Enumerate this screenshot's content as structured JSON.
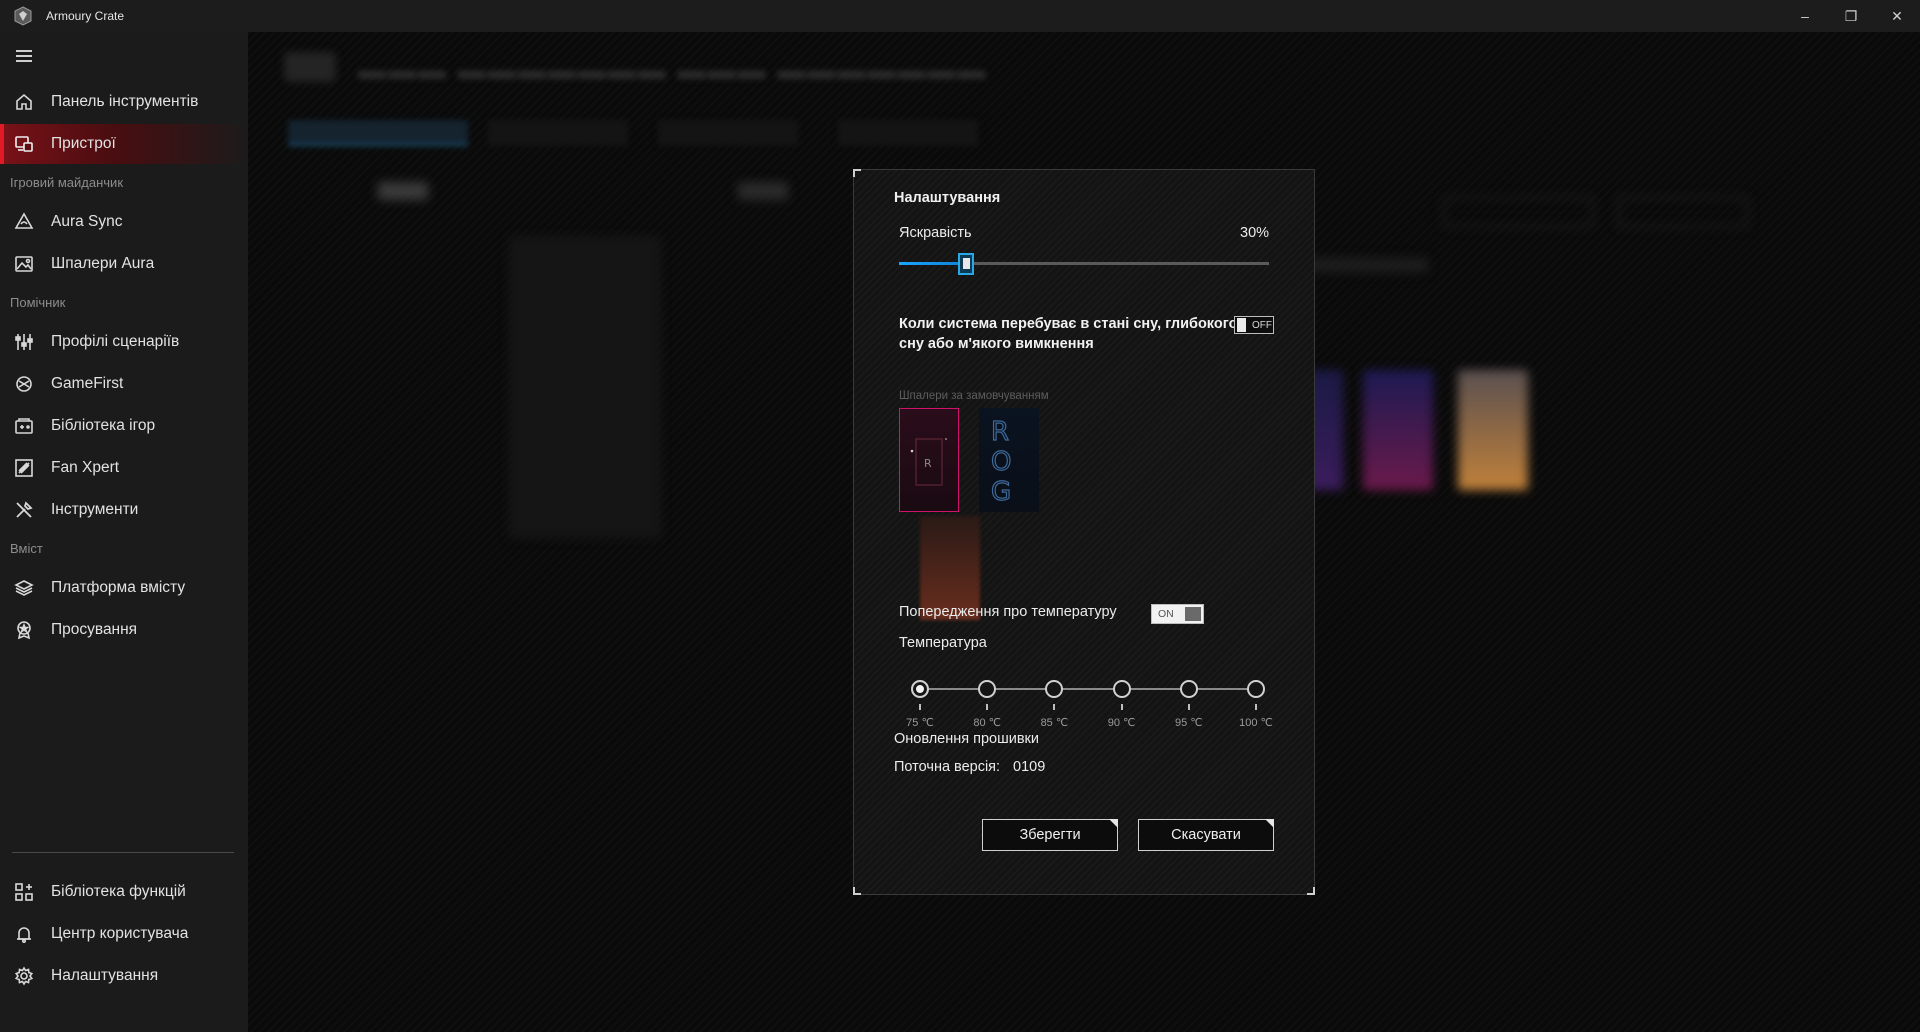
{
  "window": {
    "title": "Armoury Crate",
    "controls": [
      "–",
      "❐",
      "✕"
    ]
  },
  "sidebar": {
    "items_top": [
      {
        "label": "Панель інструментів",
        "icon": "home-icon"
      },
      {
        "label": "Пристрої",
        "icon": "devices-icon",
        "active": true
      }
    ],
    "section_gaming": "Ігровий майданчик",
    "items_gaming": [
      {
        "label": "Aura Sync",
        "icon": "aura-sync-icon"
      },
      {
        "label": "Шпалери Aura",
        "icon": "wallpaper-icon"
      }
    ],
    "section_helper": "Помічник",
    "items_helper": [
      {
        "label": "Профілі сценаріїв",
        "icon": "sliders-icon"
      },
      {
        "label": "GameFirst",
        "icon": "gamefirst-icon"
      },
      {
        "label": "Бібліотека ігор",
        "icon": "game-library-icon"
      },
      {
        "label": "Fan Xpert",
        "icon": "fan-icon"
      },
      {
        "label": "Інструменти",
        "icon": "tools-icon"
      }
    ],
    "section_content": "Вміст",
    "items_content": [
      {
        "label": "Платформа вмісту",
        "icon": "layers-icon"
      },
      {
        "label": "Просування",
        "icon": "badge-icon"
      }
    ],
    "items_bottom": [
      {
        "label": "Бібліотека функцій",
        "icon": "feature-library-icon"
      },
      {
        "label": "Центр користувача",
        "icon": "user-center-icon"
      },
      {
        "label": "Налаштування",
        "icon": "gear-icon"
      }
    ]
  },
  "modal": {
    "title": "Налаштування",
    "brightness_label": "Яскравість",
    "brightness_value": "30%",
    "brightness_level": 0.3,
    "sleep_text": "Коли система перебуває в стані сну, глибокого сну або м'якого вимкнення",
    "sleep_toggle": "OFF",
    "wallpaper_label": "Шпалери за замовчуванням",
    "temp_warning_label": "Попередження про температуру",
    "temp_warning_toggle": "ON",
    "temperature_label": "Температура",
    "temperature_options": [
      "75 ℃",
      "80 ℃",
      "85 ℃",
      "90 ℃",
      "95 ℃",
      "100 ℃"
    ],
    "temperature_selected": "75 ℃",
    "firmware_label": "Оновлення прошивки",
    "current_version_label": "Поточна версія:",
    "current_version_value": "0109",
    "save_button": "Зберегти",
    "cancel_button": "Скасувати"
  },
  "colors": {
    "accent_red": "#e01b25",
    "slider_blue": "#1aa6ff",
    "selected_wallpaper_border": "#d2136b"
  }
}
